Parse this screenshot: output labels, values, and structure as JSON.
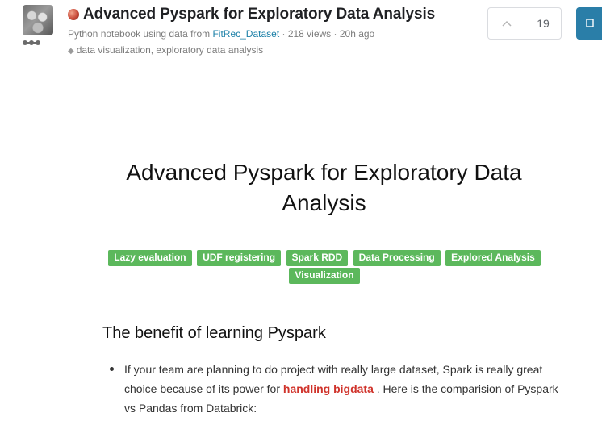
{
  "header": {
    "title": "Advanced Pyspark for Exploratory Data Analysis",
    "subtitle_prefix": "Python notebook using data from ",
    "dataset_link": "FitRec_Dataset",
    "subtitle_suffix": " · 218 views · 20h ago",
    "tags": "data visualization, exploratory data analysis",
    "vote_count": "19"
  },
  "notebook": {
    "heading": "Advanced Pyspark for Exploratory Data Analysis",
    "badges": [
      "Lazy evaluation",
      "UDF registering",
      "Spark RDD",
      "Data Processing",
      "Explored Analysis",
      "Visualization"
    ],
    "section_heading": "The benefit of learning Pyspark",
    "bullet_part1": "If your team are planning to do project with really large dataset, Spark is really great choice because of its power for ",
    "bullet_highlight": "handling bigdata",
    "bullet_part2": " . Here is the comparision of Pyspark vs Pandas from Databrick:"
  },
  "colors": {
    "badge": "#5cb85c",
    "link": "#1a7fa7",
    "highlight": "#d0332b",
    "primary_button": "#2a7ea8"
  },
  "icons": [
    "avatar",
    "tier-icon",
    "medal-icon",
    "tag-icon",
    "upvote-icon",
    "copy-icon"
  ]
}
